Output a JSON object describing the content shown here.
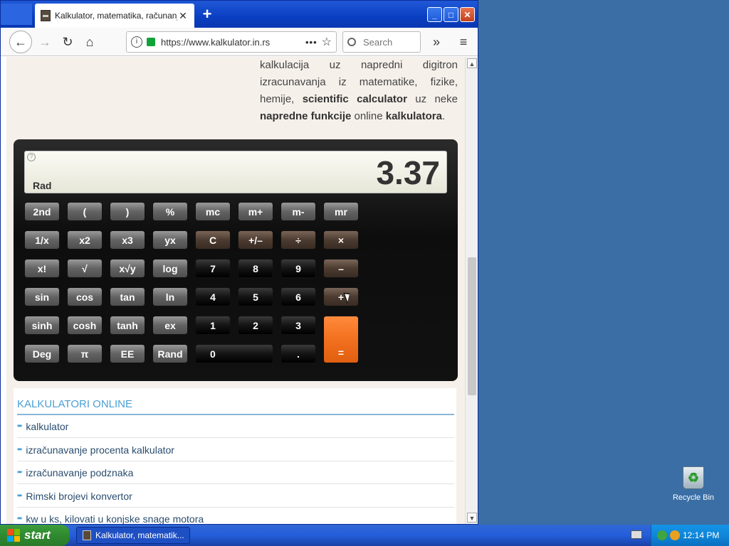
{
  "browser": {
    "tab_title": "Kalkulator, matematika, računanje",
    "tab_close": "✕",
    "new_tab": "+",
    "url": "https://www.kalkulator.in.rs",
    "url_more": "•••",
    "search_placeholder": "Search",
    "overflow": "»",
    "menu": "≡"
  },
  "window_buttons": {
    "minimize": "_",
    "maximize": "□",
    "close": "✕"
  },
  "page": {
    "intro_parts": {
      "a": "kalkulacija uz napredni digitron izracunavanja iz matematike, fizike, hemije, ",
      "b": "scientific calculator",
      "c": " uz neke ",
      "d": "napredne funkcije",
      "e": " online ",
      "f": "kalkulatora",
      "g": "."
    },
    "calculator": {
      "display_value": "3.37",
      "mode": "Rad",
      "help": "?",
      "keys": {
        "k_2nd": "2nd",
        "k_lparen": "(",
        "k_rparen": ")",
        "k_percent": "%",
        "k_mc": "mc",
        "k_mplus": "m+",
        "k_mminus": "m-",
        "k_mr": "mr",
        "k_inv": "1/x",
        "k_x2": "x2",
        "k_x3": "x3",
        "k_yx": "yx",
        "k_c": "C",
        "k_sign": "+/–",
        "k_div": "÷",
        "k_mul": "×",
        "k_fact": "x!",
        "k_sqrt": "√",
        "k_root": "x√y",
        "k_log": "log",
        "k_7": "7",
        "k_8": "8",
        "k_9": "9",
        "k_minus": "–",
        "k_sin": "sin",
        "k_cos": "cos",
        "k_tan": "tan",
        "k_ln": "ln",
        "k_4": "4",
        "k_5": "5",
        "k_6": "6",
        "k_plus": "+",
        "k_sinh": "sinh",
        "k_cosh": "cosh",
        "k_tanh": "tanh",
        "k_ex": "ex",
        "k_1": "1",
        "k_2": "2",
        "k_3": "3",
        "k_eq": "=",
        "k_deg": "Deg",
        "k_pi": "π",
        "k_ee": "EE",
        "k_rand": "Rand",
        "k_0": "0",
        "k_dot": "."
      }
    },
    "links_heading": "KALKULATORI ONLINE",
    "links": [
      "kalkulator",
      "izračunavanje procenta kalkulator",
      "izračunavanje podznaka",
      "Rimski brojevi konvertor",
      "kw u ks, kilovati u konjske snage motora"
    ]
  },
  "taskbar": {
    "start": "start",
    "task_label": "Kalkulator, matematik...",
    "clock": "12:14 PM"
  },
  "desktop": {
    "recycle_bin": "Recycle Bin"
  },
  "colors": {
    "accent": "#4a9fd4",
    "equals_key": "#f2701e",
    "taskbar": "#245edb"
  }
}
